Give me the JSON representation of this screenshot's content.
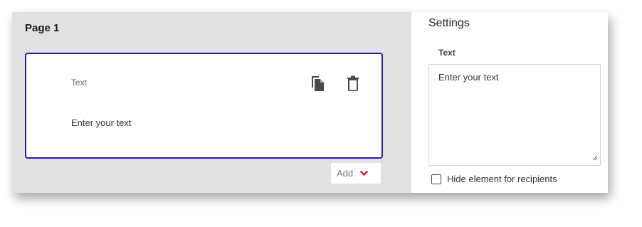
{
  "canvas": {
    "page_title": "Page 1",
    "card": {
      "label": "Text",
      "value": "Enter your text",
      "icons": {
        "copy": "copy-icon",
        "delete": "trash-icon"
      }
    },
    "add_button": {
      "label": "Add",
      "icon": "chevron-down-icon"
    }
  },
  "settings": {
    "title": "Settings",
    "text_field": {
      "label": "Text",
      "value": "Enter your text"
    },
    "hide_checkbox": {
      "label": "Hide element for recipients",
      "checked": false
    }
  },
  "colors": {
    "card_border": "#1b2296",
    "canvas_bg": "#e2e2e2",
    "accent_red": "#d0021b"
  }
}
